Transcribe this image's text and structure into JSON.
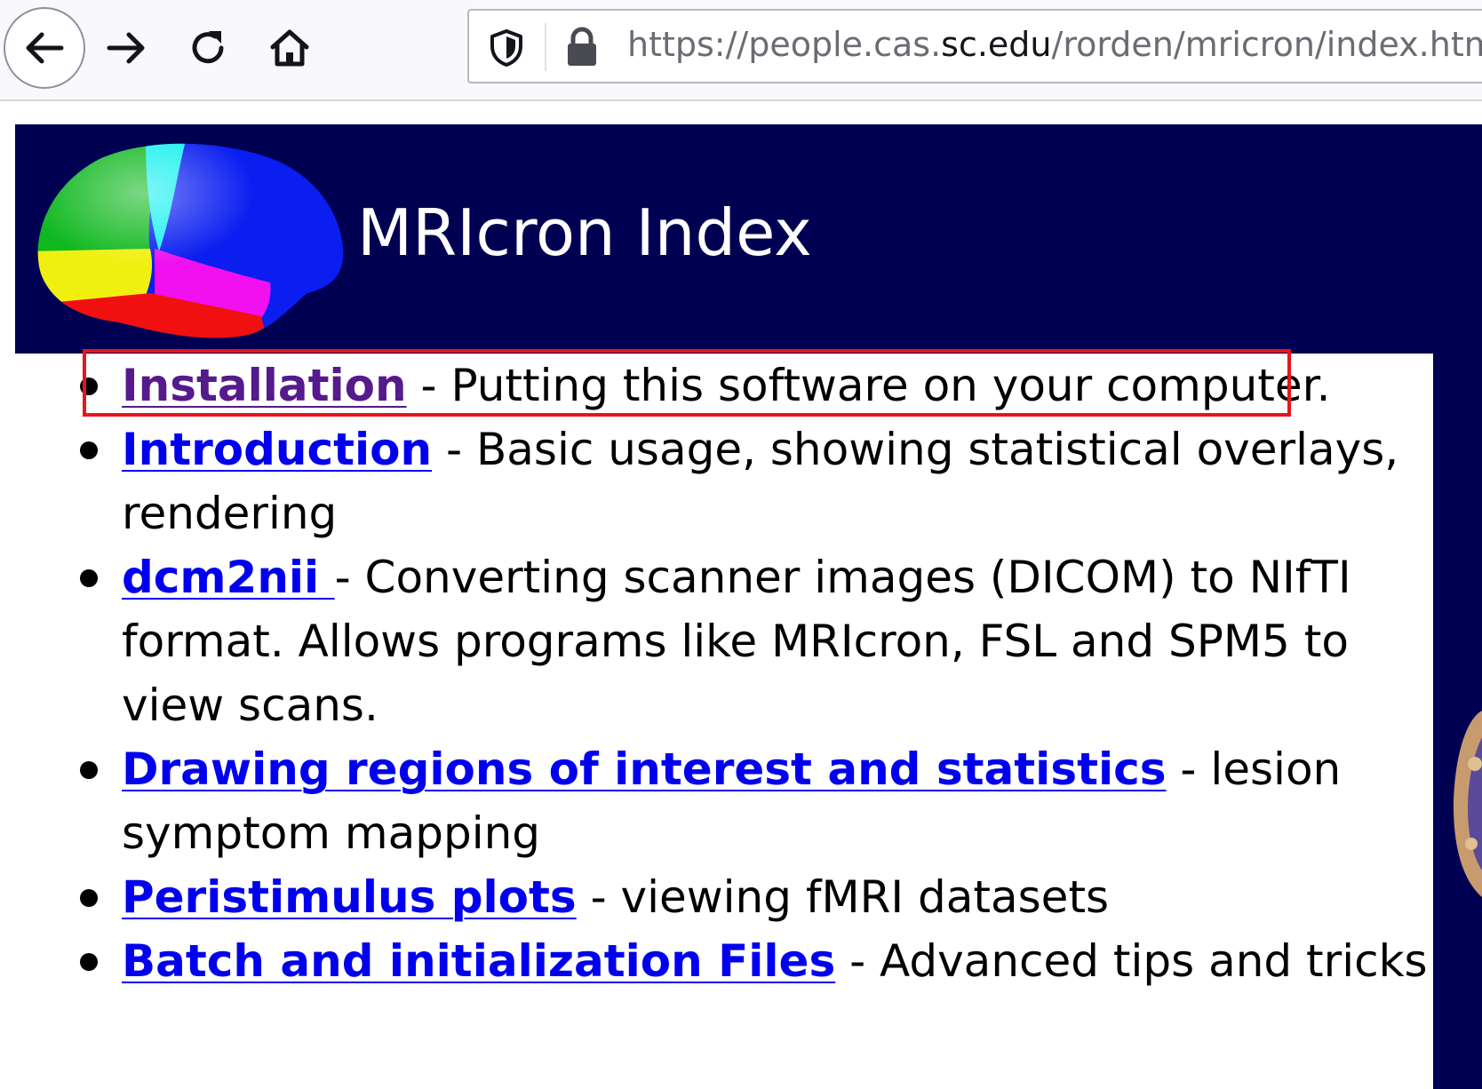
{
  "browser": {
    "url_prefix": "https://people.cas.",
    "url_domain": "sc.edu",
    "url_suffix": "/rorden/mricron/index.html",
    "icons": [
      "back-arrow-icon",
      "forward-arrow-icon",
      "reload-icon",
      "home-icon",
      "shield-icon",
      "lock-icon"
    ]
  },
  "page": {
    "title": "MRIcron Index",
    "header_bg": "#000052",
    "link_color": "#0000ee",
    "visited_link_color": "#551a8b",
    "highlight_color": "#e8141c",
    "items": [
      {
        "link": "Installation",
        "desc": " - Putting this software on your computer.",
        "visited": true
      },
      {
        "link": "Introduction",
        "desc": " - Basic usage, showing statistical overlays, rendering"
      },
      {
        "link": "dcm2nii ",
        "desc": "- Converting scanner images (DICOM) to NIfTI format. Allows programs like MRIcron, FSL and SPM5 to view scans."
      },
      {
        "link": "Drawing regions of interest and statistics",
        "desc": " - lesion symptom mapping"
      },
      {
        "link": "Peristimulus plots",
        "desc": " - viewing fMRI datasets"
      },
      {
        "link": "Batch and initialization Files",
        "desc": " - Advanced tips and tricks"
      }
    ]
  }
}
